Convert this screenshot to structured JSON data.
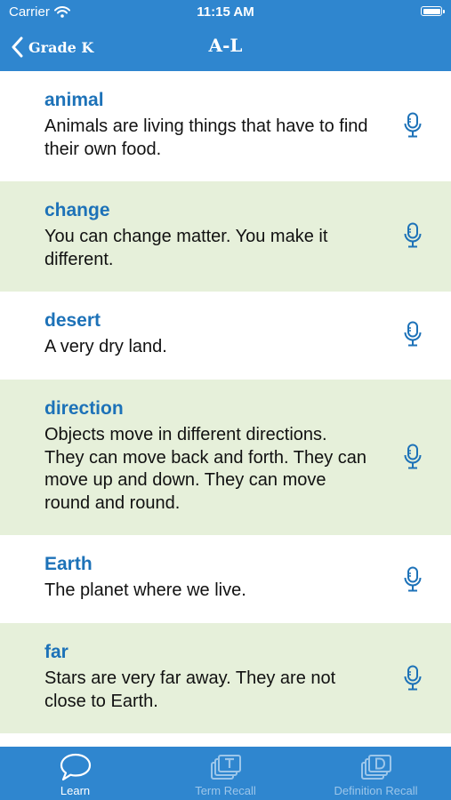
{
  "status_bar": {
    "carrier": "Carrier",
    "time": "11:15 AM"
  },
  "nav": {
    "back_label": "Grade K",
    "title": "A-L"
  },
  "terms": [
    {
      "term": "animal",
      "definition": "Animals are living things that have to find their own food."
    },
    {
      "term": "change",
      "definition": "You can change matter. You make it different."
    },
    {
      "term": "desert",
      "definition": "A very dry land."
    },
    {
      "term": "direction",
      "definition": "Objects move in different directions. They can move back and forth. They can move up and down. They can move round and round."
    },
    {
      "term": "Earth",
      "definition": "The planet where we live."
    },
    {
      "term": "far",
      "definition": "Stars are very far away. They are not close to Earth."
    }
  ],
  "tabs": [
    {
      "label": "Learn",
      "icon": "speech-bubble-icon",
      "active": true
    },
    {
      "label": "Term Recall",
      "icon": "term-cards-icon",
      "active": false
    },
    {
      "label": "Definition Recall",
      "icon": "definition-cards-icon",
      "active": false
    }
  ],
  "colors": {
    "header": "#2f86cf",
    "term": "#1d72b8",
    "alt_row": "#e6f0da",
    "tab_inactive": "#9cc6ea"
  }
}
